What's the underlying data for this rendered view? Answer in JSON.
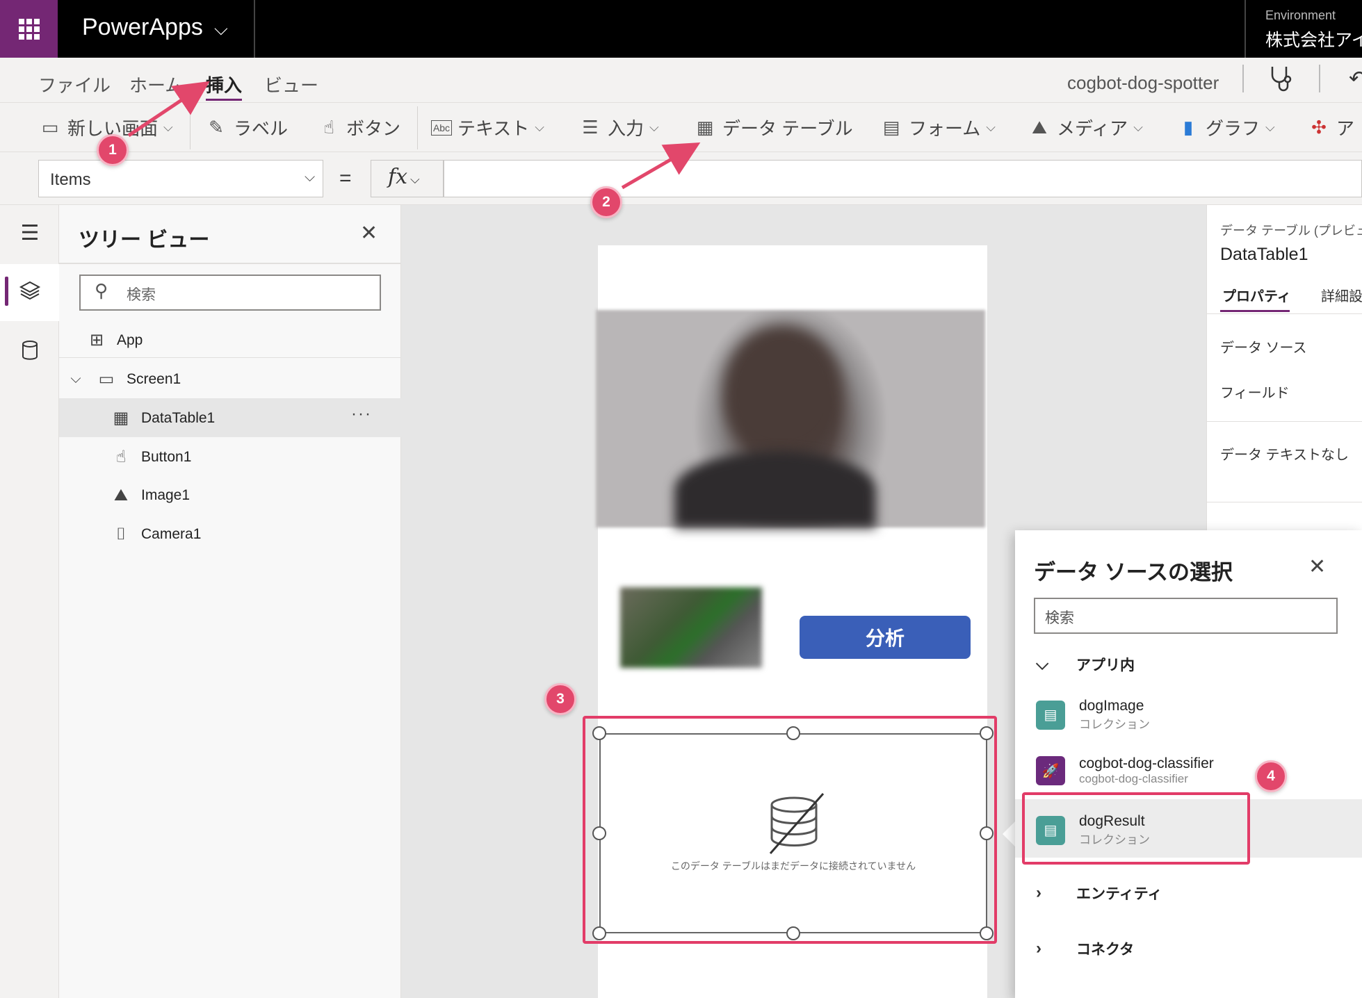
{
  "topbar": {
    "app_name": "PowerApps",
    "env_label": "Environment",
    "env_value": "株式会社アイ"
  },
  "menu": {
    "file": "ファイル",
    "home": "ホーム",
    "insert": "挿入",
    "view": "ビュー",
    "app_file": "cogbot-dog-spotter"
  },
  "ribbon": {
    "new_screen": "新しい画面",
    "label": "ラベル",
    "button": "ボタン",
    "text": "テキスト",
    "input": "入力",
    "data_table": "データ テーブル",
    "form": "フォーム",
    "media": "メディア",
    "chart": "グラフ",
    "ai": "ア"
  },
  "formula": {
    "property": "Items",
    "equals": "=",
    "fx": "fx",
    "value": ""
  },
  "tree": {
    "title": "ツリー ビュー",
    "search_placeholder": "検索",
    "items": [
      {
        "label": "App"
      },
      {
        "label": "Screen1"
      },
      {
        "label": "DataTable1"
      },
      {
        "label": "Button1"
      },
      {
        "label": "Image1"
      },
      {
        "label": "Camera1"
      }
    ]
  },
  "canvas": {
    "analyze_button": "分析",
    "datatable_message": "このデータ テーブルはまだデータに接続されていません"
  },
  "props": {
    "kind": "データ テーブル (プレビュー)",
    "name": "DataTable1",
    "tab_properties": "プロパティ",
    "tab_advanced": "詳細設",
    "data_source": "データ ソース",
    "fields": "フィールド",
    "no_data_text": "データ テキストなし"
  },
  "flyout": {
    "title": "データ ソースの選択",
    "search_placeholder": "検索",
    "section_in_app": "アプリ内",
    "sources": [
      {
        "name": "dogImage",
        "sub": "コレクション"
      },
      {
        "name": "cogbot-dog-classifier",
        "sub": "cogbot-dog-classifier"
      },
      {
        "name": "dogResult",
        "sub": "コレクション"
      }
    ],
    "section_entities": "エンティティ",
    "section_connectors": "コネクタ"
  },
  "annotations": {
    "badges": [
      "1",
      "2",
      "3",
      "4"
    ]
  },
  "colors": {
    "accent_purple": "#742774",
    "annotation_pink": "#e23c68",
    "button_blue": "#3a5fb8",
    "collection_teal": "#4a9e96"
  }
}
